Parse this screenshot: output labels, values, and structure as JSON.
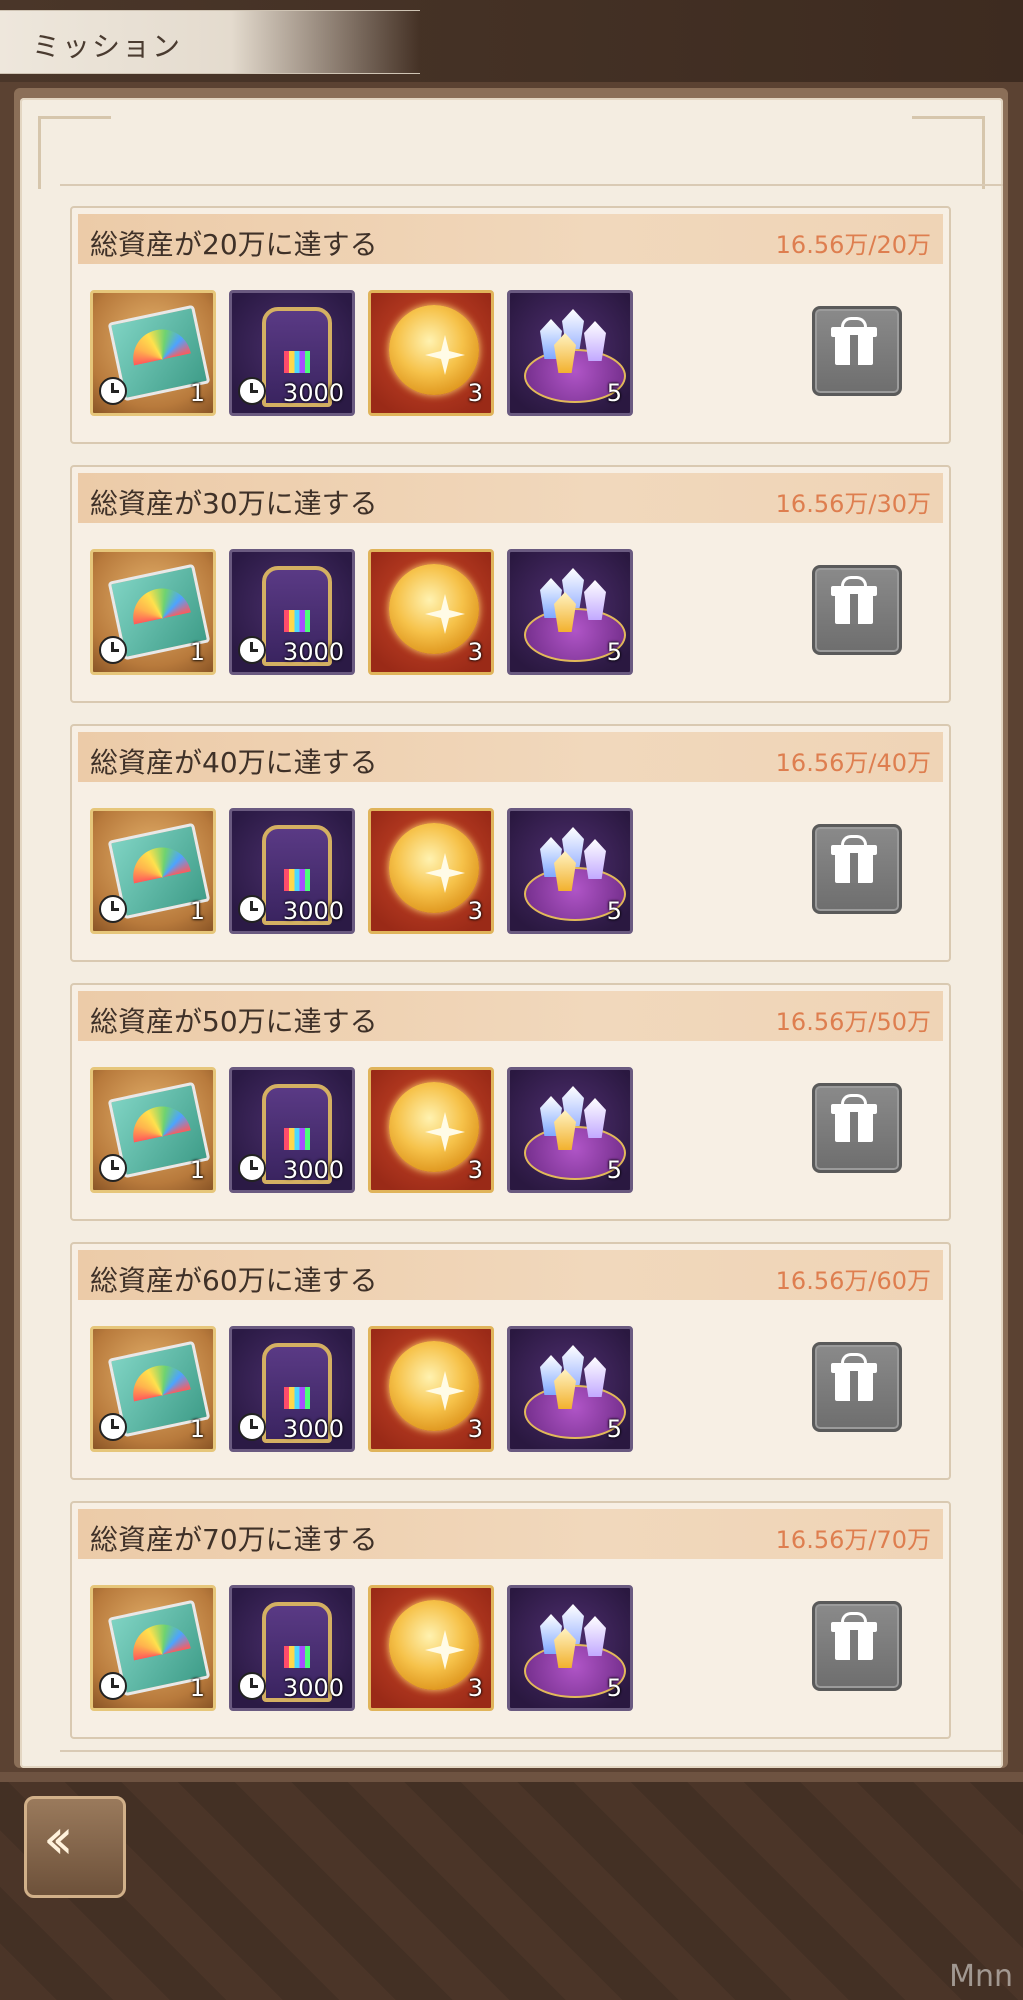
{
  "header": {
    "title": "ミッション"
  },
  "missions": [
    {
      "title": "総資産が20万に達する",
      "progress": "16.56万/20万",
      "rewards": [
        "1",
        "3000",
        "3",
        "5"
      ]
    },
    {
      "title": "総資産が30万に達する",
      "progress": "16.56万/30万",
      "rewards": [
        "1",
        "3000",
        "3",
        "5"
      ]
    },
    {
      "title": "総資産が40万に達する",
      "progress": "16.56万/40万",
      "rewards": [
        "1",
        "3000",
        "3",
        "5"
      ]
    },
    {
      "title": "総資産が50万に達する",
      "progress": "16.56万/50万",
      "rewards": [
        "1",
        "3000",
        "3",
        "5"
      ]
    },
    {
      "title": "総資産が60万に達する",
      "progress": "16.56万/60万",
      "rewards": [
        "1",
        "3000",
        "3",
        "5"
      ]
    },
    {
      "title": "総資産が70万に達する",
      "progress": "16.56万/70万",
      "rewards": [
        "1",
        "3000",
        "3",
        "5"
      ]
    }
  ],
  "reward_icons": [
    "rainbow-ticket-icon",
    "stamina-frame-icon",
    "golden-orb-icon",
    "gem-cushion-icon"
  ],
  "gift_button_icon": "gift-icon",
  "footer": {
    "back_icon": "double-chevron-left-icon"
  },
  "watermark": "Mnn",
  "colors": {
    "progress": "#de7e4f",
    "gift_button": "#7a7a7a"
  }
}
